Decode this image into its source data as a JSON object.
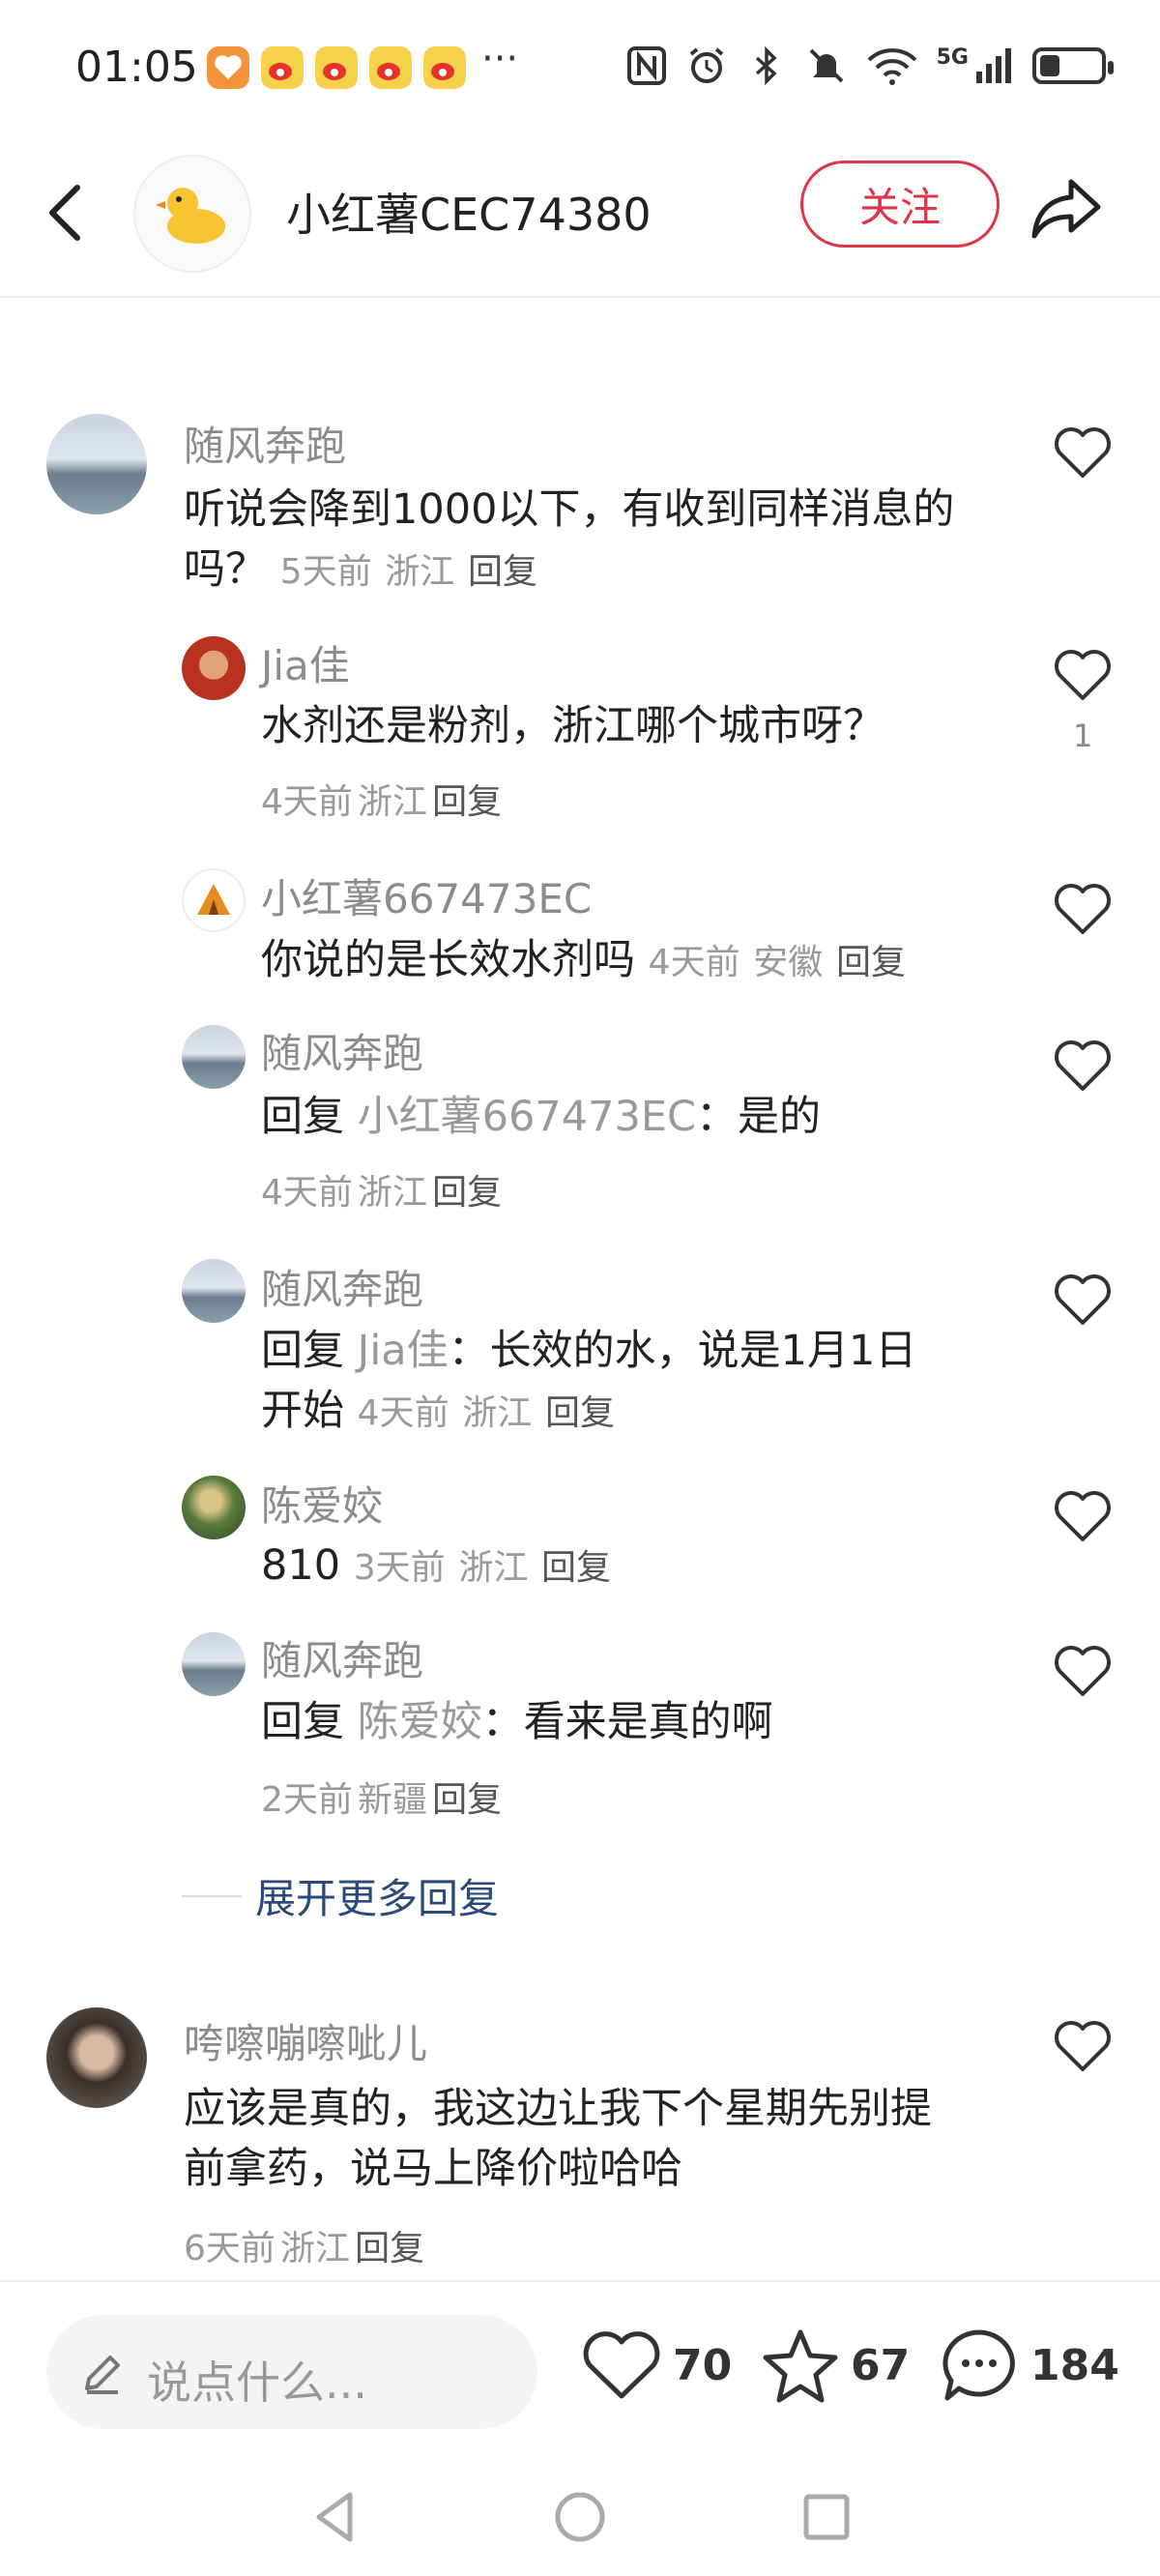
{
  "status": {
    "time": "01:05",
    "more": "···",
    "network": "5G",
    "notification_icons": [
      "health-app-icon",
      "weibo-icon",
      "weibo-icon",
      "weibo-icon",
      "weibo-icon"
    ],
    "right_icons": [
      "nfc-icon",
      "alarm-icon",
      "bluetooth-icon",
      "mute-icon",
      "wifi-icon",
      "signal-icon",
      "battery-icon"
    ]
  },
  "header": {
    "back_icon": "chevron-left-icon",
    "avatar_icon": "duck-icon",
    "username": "小红薯CEC74380",
    "follow_label": "关注",
    "share_icon": "share-icon"
  },
  "colors": {
    "accent": "#e0344a",
    "link": "#2b4a7a",
    "muted": "#999999"
  },
  "comments": [
    {
      "name": "随风奔跑",
      "text": "听说会降到1000以下，有收到同样消息的",
      "text_cont": "吗？",
      "time": "5天前",
      "location": "浙江",
      "reply_label": "回复",
      "replies": [
        {
          "name": "Jia佳",
          "text": "水剂还是粉剂，浙江哪个城市呀？",
          "time": "4天前",
          "location": "浙江",
          "reply_label": "回复",
          "likes": "1"
        },
        {
          "name": "小红薯667473EC",
          "text": "你说的是长效水剂吗",
          "time": "4天前",
          "location": "安徽",
          "reply_label": "回复"
        },
        {
          "name": "随风奔跑",
          "reply_prefix": "回复",
          "reply_to": "小红薯667473EC",
          "text": "：是的",
          "time": "4天前",
          "location": "浙江",
          "reply_label": "回复"
        },
        {
          "name": "随风奔跑",
          "reply_prefix": "回复",
          "reply_to": "Jia佳",
          "text": "：长效的水，说是1月1日",
          "text_cont": "开始",
          "time": "4天前",
          "location": "浙江",
          "reply_label": "回复"
        },
        {
          "name": "陈爱姣",
          "text": "810",
          "time": "3天前",
          "location": "浙江",
          "reply_label": "回复"
        },
        {
          "name": "随风奔跑",
          "reply_prefix": "回复",
          "reply_to": "陈爱姣",
          "text": "：看来是真的啊",
          "time": "2天前",
          "location": "新疆",
          "reply_label": "回复"
        }
      ],
      "expand_label": "展开更多回复"
    },
    {
      "name": "咵嚓嘣嚓呲儿",
      "text": "应该是真的，我这边让我下个星期先别提",
      "text_cont": "前拿药，说马上降价啦哈哈",
      "time": "6天前",
      "location": "浙江",
      "reply_label": "回复"
    }
  ],
  "bottom": {
    "input_placeholder": "说点什么...",
    "likes": "70",
    "stars": "67",
    "comments": "184"
  },
  "nav": {
    "icons": [
      "back-triangle-icon",
      "home-circle-icon",
      "recents-square-icon"
    ]
  }
}
